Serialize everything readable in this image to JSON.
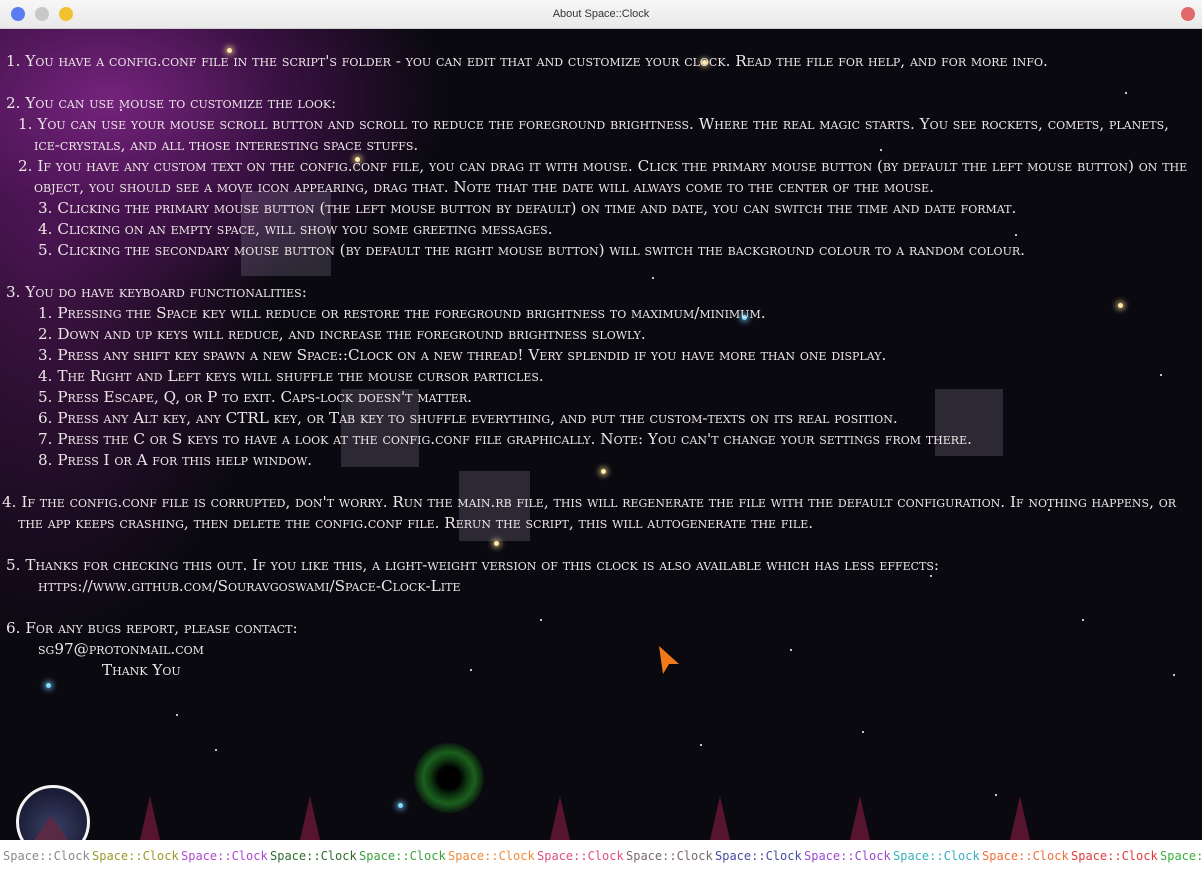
{
  "window": {
    "title": "About Space::Clock"
  },
  "help": {
    "l1": "1. You have a config.conf file in the script's folder - you can edit that and customize your clock. Read the file for help, and for more info.",
    "l2": "2. You can use mouse to customize the look:",
    "l2_1": "1. You can use your mouse scroll button and scroll to reduce the foreground brightness. Where the real magic starts. You see rockets, comets, planets, ice-crystals, and all those interesting space stuffs.",
    "l2_2": "2. If you have any custom text on the config.conf file, you can drag it with mouse. Click the primary mouse button (by default the left mouse button) on the object, you should see a move icon appearing, drag that. Note that the date will always come to the center of the mouse.",
    "l2_3": "3. Clicking the primary mouse button (the left mouse button by default) on time and date, you can switch the time and date format.",
    "l2_4": "4. Clicking on an empty space, will show you some greeting messages.",
    "l2_5": "5. Clicking the secondary mouse button (by default the right mouse button) will switch the background colour to a random colour.",
    "l3": "3. You do have keyboard functionalities:",
    "l3_1": "1. Pressing the Space key will reduce or restore the foreground brightness to maximum/minimum.",
    "l3_2": "2. Down and up keys will reduce, and increase the foreground brightness slowly.",
    "l3_3": "3. Press any shift key spawn a new Space::Clock on a new thread! Very splendid if you have more than one display.",
    "l3_4": "4. The Right and Left keys will shuffle the mouse cursor particles.",
    "l3_5": "5. Press Escape, Q, or P to exit. Caps-lock doesn't matter.",
    "l3_6": "6. Press any Alt key, any CTRL key, or Tab key to shuffle everything, and put the custom-texts on its real position.",
    "l3_7": "7. Press the C or S keys to have a look at the config.conf file graphically. Note: You can't change your settings from there.",
    "l3_8": "8. Press I or A for this help window.",
    "l4": "4. If the config.conf file is corrupted, don't worry. Run the main.rb file, this will regenerate the file with the default configuration. If nothing happens, or the app keeps crashing, then delete the config.conf file. Rerun the script, this will autogenerate the file.",
    "l5": "5. Thanks for checking this out. If you like this, a light-weight version of this clock is also available which has less effects:",
    "l5_link": "https://www.github.com/Souravgoswami/Space-Clock-Lite",
    "l6": "6. For any bugs report, please contact:",
    "l6_email": "sg97@protonmail.com",
    "l6_thanks": "Thank You"
  },
  "footer": {
    "items": [
      {
        "label": "Space::Clock",
        "color": "#8a8a8a"
      },
      {
        "label": "Space::Clock",
        "color": "#9a9a2a"
      },
      {
        "label": "Space::Clock",
        "color": "#b04ad0"
      },
      {
        "label": "Space::Clock",
        "color": "#2f6a2f"
      },
      {
        "label": "Space::Clock",
        "color": "#3aa03a"
      },
      {
        "label": "Space::Clock",
        "color": "#f08a3a"
      },
      {
        "label": "Space::Clock",
        "color": "#e0507a"
      },
      {
        "label": "Space::Clock",
        "color": "#7a6a6a"
      },
      {
        "label": "Space::Clock",
        "color": "#4a4aa0"
      },
      {
        "label": "Space::Clock",
        "color": "#9a4ad0"
      },
      {
        "label": "Space::Clock",
        "color": "#3ab0c0"
      },
      {
        "label": "Space::Clock",
        "color": "#f0703a"
      },
      {
        "label": "Space::Clock",
        "color": "#e03a3a"
      },
      {
        "label": "Space::",
        "color": "#3ab03a"
      }
    ]
  }
}
